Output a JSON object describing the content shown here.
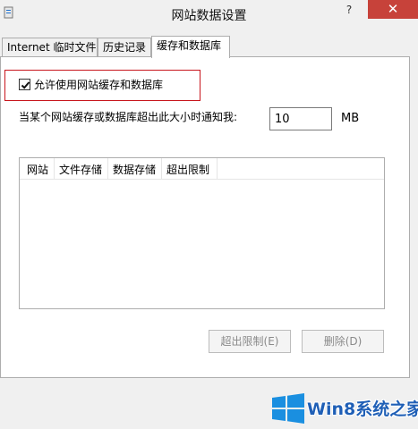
{
  "window": {
    "title": "网站数据设置",
    "help_label": "?",
    "close_label": "✕"
  },
  "tabs": [
    {
      "label": "Internet 临时文件",
      "active": false
    },
    {
      "label": "历史记录",
      "active": false
    },
    {
      "label": "缓存和数据库",
      "active": true
    }
  ],
  "settings": {
    "allow_cache_label": "允许使用网站缓存和数据库",
    "allow_cache_checked": true,
    "notify_label": "当某个网站缓存或数据库超出此大小时通知我:",
    "size_value": "10",
    "size_unit": "MB"
  },
  "table": {
    "columns": [
      "网站",
      "文件存储",
      "数据存储",
      "超出限制"
    ],
    "rows": []
  },
  "buttons": {
    "limit_label": "超出限制(E)",
    "delete_label": "删除(D)"
  },
  "watermark": {
    "text": "Win8系统之家"
  },
  "colors": {
    "close_button": "#c7423a",
    "highlight_border": "#c8151d",
    "watermark_text": "#1f5fb6",
    "windows_logo": "#1a8fe0"
  }
}
